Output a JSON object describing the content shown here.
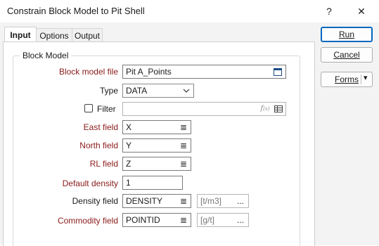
{
  "window": {
    "title": "Constrain Block Model to Pit Shell",
    "help_label": "?",
    "close_label": "✕"
  },
  "tabs": [
    {
      "label": "Input"
    },
    {
      "label": "Options"
    },
    {
      "label": "Output"
    }
  ],
  "buttons": {
    "run": "Run",
    "cancel": "Cancel",
    "forms": "Forms",
    "forms_arrow": "▾"
  },
  "group": {
    "title": "Block Model"
  },
  "fields": {
    "block_model_file": {
      "label": "Block model file",
      "value": "Pit A_Points",
      "icon": "file-browse-icon"
    },
    "type": {
      "label": "Type",
      "value": "DATA",
      "icon": "chevron-down-icon"
    },
    "filter": {
      "label": "Filter",
      "value": "",
      "checked": false,
      "icons": [
        "function-icon",
        "table-icon"
      ]
    },
    "east": {
      "label": "East field",
      "value": "X"
    },
    "north": {
      "label": "North field",
      "value": "Y"
    },
    "rl": {
      "label": "RL field",
      "value": "Z"
    },
    "default_density": {
      "label": "Default density",
      "value": "1"
    },
    "density": {
      "label": "Density field",
      "value": "DENSITY",
      "unit": "[t/m3]"
    },
    "commodity": {
      "label": "Commodity field",
      "value": "POINTID",
      "unit": "[g/t]"
    }
  },
  "glyphs": {
    "list": "≣",
    "ellipsis": "..."
  },
  "colors": {
    "required_label": "#8b1a1a",
    "primary_button_border": "#0067c0"
  }
}
